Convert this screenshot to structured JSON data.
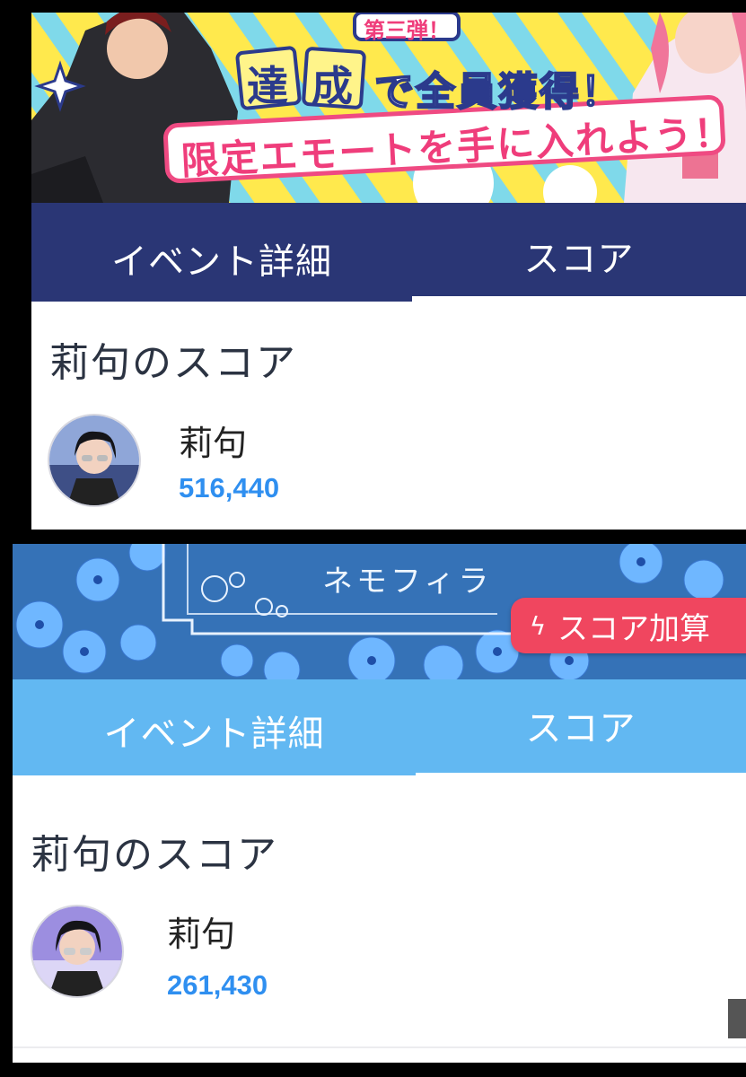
{
  "panels": [
    {
      "banner": {
        "subtitle": "第三弾！",
        "headline_box_1": "達",
        "headline_box_2": "成",
        "headline_rest": "で全員獲得！",
        "headline_line2": "限定エモートを手に入れよう！"
      },
      "tabs": {
        "left": "イベント詳細",
        "right": "スコア"
      },
      "score_title": "莉句のスコア",
      "player": {
        "name": "莉句",
        "score": "516,440"
      },
      "colors": {
        "tab_bg": "#2a3675"
      }
    },
    {
      "banner": {
        "title": "ネモフィラ",
        "badge_label": "スコア加算",
        "badge_icon": "lightning-icon"
      },
      "tabs": {
        "left": "イベント詳細",
        "right": "スコア"
      },
      "score_title": "莉句のスコア",
      "player": {
        "name": "莉句",
        "score": "261,430"
      },
      "colors": {
        "tab_bg": "#62b8f2",
        "badge": "#f0465f"
      }
    }
  ],
  "colors": {
    "score": "#2f8ff0",
    "title_text": "#2b3342"
  }
}
